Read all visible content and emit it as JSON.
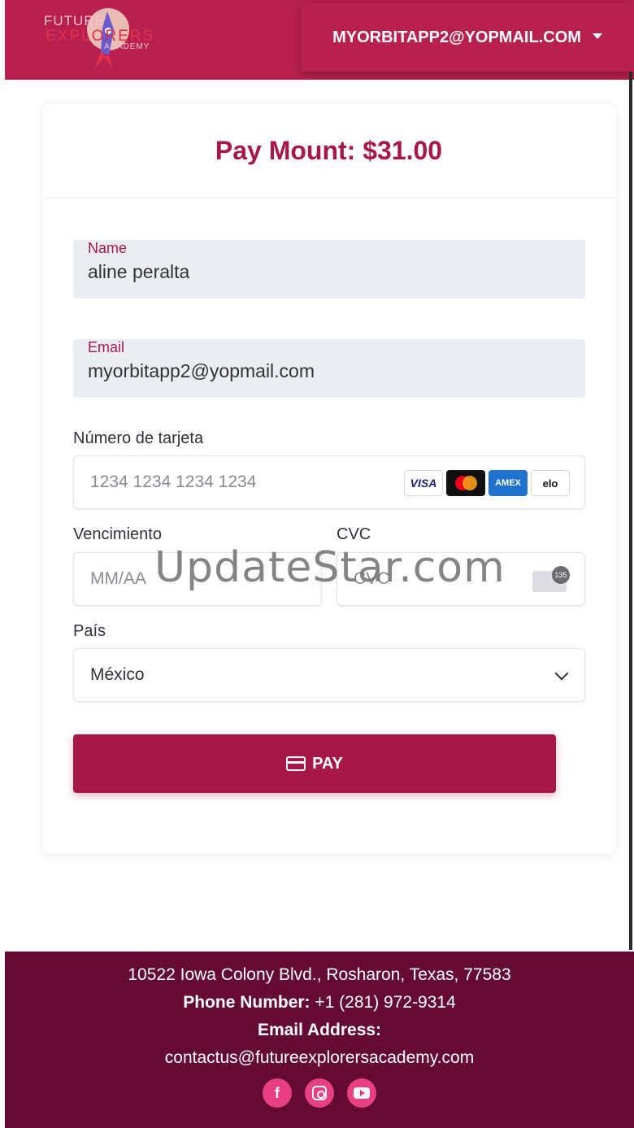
{
  "header": {
    "logo": {
      "line1": "FUTURE",
      "line2": "EXPLORERS",
      "line3": "ACADEMY"
    },
    "user_email": "MYORBITAPP2@YOPMAIL.COM"
  },
  "payment": {
    "title": "Pay Mount: $31.00",
    "name_label": "Name",
    "name_value": "aline peralta",
    "email_label": "Email",
    "email_value": "myorbitapp2@yopmail.com",
    "card_number_label": "Número de tarjeta",
    "card_number_placeholder": "1234 1234 1234 1234",
    "card_brands": [
      "VISA",
      "mastercard",
      "AMEX",
      "elo"
    ],
    "expiry_label": "Vencimiento",
    "expiry_placeholder": "MM/AA",
    "cvc_label": "CVC",
    "cvc_placeholder": "CVC",
    "cvc_badge": "135",
    "country_label": "País",
    "country_value": "México",
    "pay_button": "PAY"
  },
  "watermark": "UpdateStar.com",
  "footer": {
    "address": "10522 Iowa Colony Blvd., Rosharon, Texas, 77583",
    "phone_label": "Phone Number:",
    "phone_value": "+1 (281) 972-9314",
    "email_label": "Email Address:",
    "email_value": "contactus@futureexplorersacademy.com",
    "social_icons": [
      "facebook-icon",
      "instagram-icon",
      "youtube-icon"
    ]
  },
  "colors": {
    "header_bg": "#b8204f",
    "accent": "#a8174a",
    "footer_bg": "#650a35",
    "social_bg": "#e83f82"
  }
}
